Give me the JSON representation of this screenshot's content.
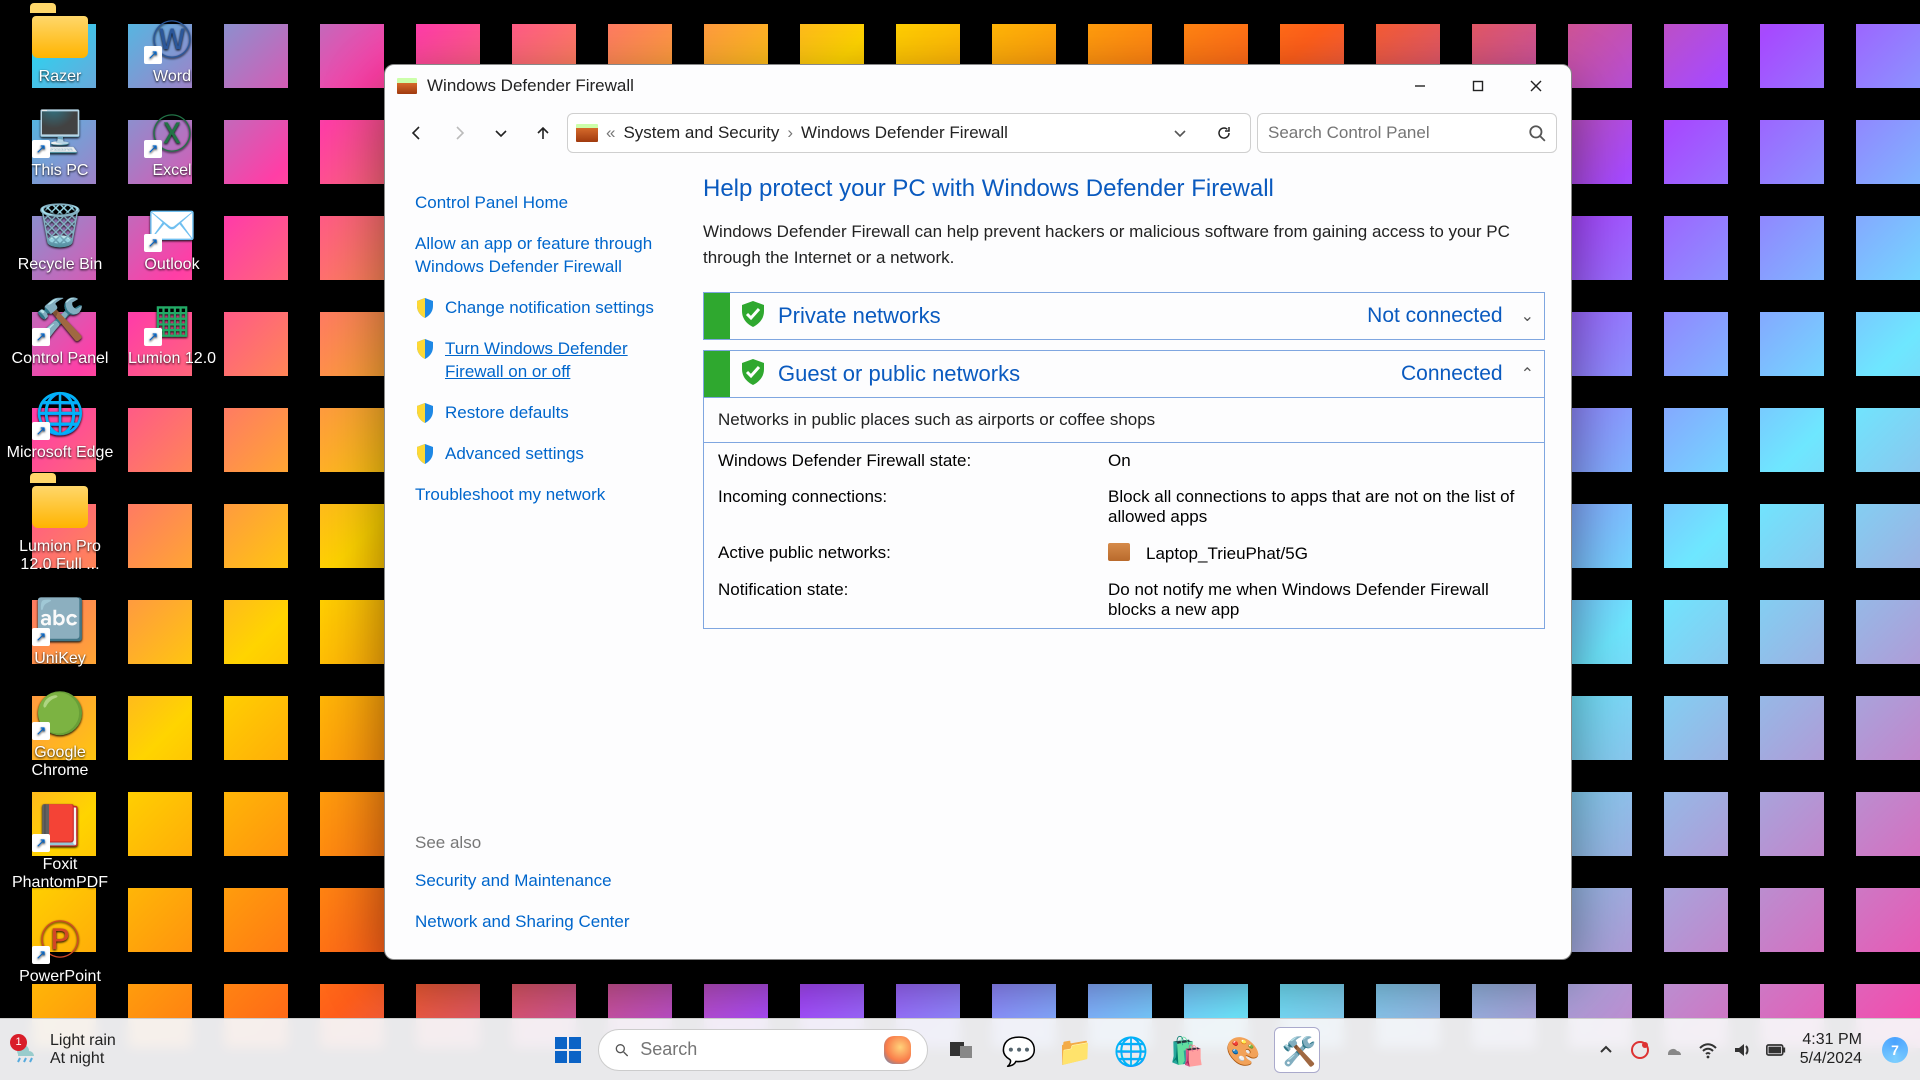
{
  "desktop": {
    "icons": [
      {
        "label": "Razer"
      },
      {
        "label": "UniKey"
      },
      {
        "label": "Outlook"
      },
      {
        "label": "This PC"
      },
      {
        "label": "Google Chrome"
      },
      {
        "label": "Lumion 12.0"
      },
      {
        "label": "Recycle Bin"
      },
      {
        "label": "Foxit PhantomPDF"
      },
      {
        "label": "Control Panel"
      },
      {
        "label": "PowerPoint"
      },
      {
        "label": "Microsoft Edge"
      },
      {
        "label": "Word"
      },
      {
        "label": "Lumion Pro 12.0 Full ..."
      },
      {
        "label": "Excel"
      }
    ]
  },
  "window": {
    "title": "Windows Defender Firewall",
    "breadcrumb": {
      "root_glyph": "«",
      "part1": "System and Security",
      "sep": "›",
      "part2": "Windows Defender Firewall"
    },
    "search_placeholder": "Search Control Panel",
    "sidebar": {
      "items": [
        {
          "label": "Control Panel Home",
          "shield": false,
          "active": false
        },
        {
          "label": "Allow an app or feature through Windows Defender Firewall",
          "shield": false,
          "active": false
        },
        {
          "label": "Change notification settings",
          "shield": true,
          "active": false
        },
        {
          "label": "Turn Windows Defender Firewall on or off",
          "shield": true,
          "active": true
        },
        {
          "label": "Restore defaults",
          "shield": true,
          "active": false
        },
        {
          "label": "Advanced settings",
          "shield": true,
          "active": false
        },
        {
          "label": "Troubleshoot my network",
          "shield": false,
          "active": false
        }
      ],
      "see_also_label": "See also",
      "see_also": [
        {
          "label": "Security and Maintenance"
        },
        {
          "label": "Network and Sharing Center"
        }
      ]
    },
    "main": {
      "heading": "Help protect your PC with Windows Defender Firewall",
      "description": "Windows Defender Firewall can help prevent hackers or malicious software from gaining access to your PC through the Internet or a network.",
      "panels": {
        "private": {
          "name": "Private networks",
          "status": "Not connected",
          "expanded": false
        },
        "public": {
          "name": "Guest or public networks",
          "status": "Connected",
          "expanded": true,
          "subtext": "Networks in public places such as airports or coffee shops",
          "rows": [
            {
              "k": "Windows Defender Firewall state:",
              "v": "On"
            },
            {
              "k": "Incoming connections:",
              "v": "Block all connections to apps that are not on the list of allowed apps"
            },
            {
              "k": "Active public networks:",
              "v": "Laptop_TrieuPhat/5G",
              "icon": true
            },
            {
              "k": "Notification state:",
              "v": "Do not notify me when Windows Defender Firewall blocks a new app"
            }
          ]
        }
      }
    }
  },
  "taskbar": {
    "weather": {
      "line1": "Light rain",
      "line2": "At night",
      "badge": "1"
    },
    "search_placeholder": "Search",
    "time": "4:31 PM",
    "date": "5/4/2024",
    "copilot_badge": "7"
  }
}
